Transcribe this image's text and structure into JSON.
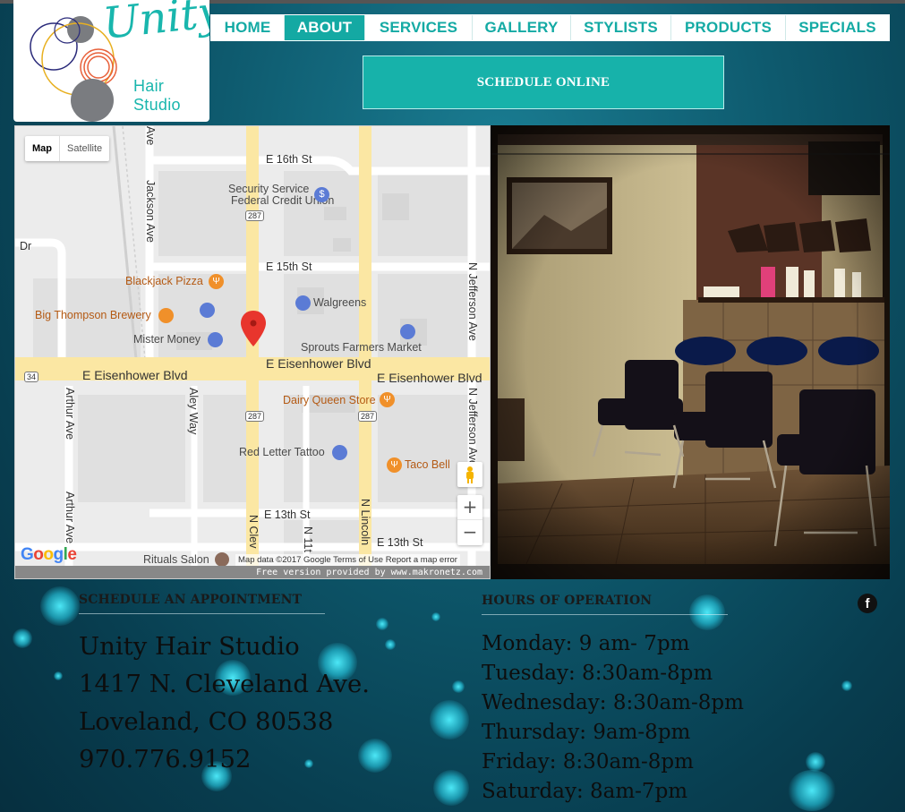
{
  "logo": {
    "script": "Unity",
    "sub": "Hair Studio"
  },
  "nav": {
    "items": [
      {
        "label": "HOME",
        "active": false
      },
      {
        "label": "ABOUT",
        "active": true
      },
      {
        "label": "SERVICES",
        "active": false
      },
      {
        "label": "GALLERY",
        "active": false
      },
      {
        "label": "STYLISTS",
        "active": false
      },
      {
        "label": "PRODUCTS",
        "active": false
      },
      {
        "label": "SPECIALS",
        "active": false
      }
    ]
  },
  "schedule_button": "SCHEDULE ONLINE",
  "map": {
    "toggle": [
      "Map",
      "Satellite"
    ],
    "streets": {
      "e16": "E 16th St",
      "e15": "E 15th St",
      "e13a": "E 13th St",
      "e13b": "E 13th St",
      "eisen1": "E Eisenhower Blvd",
      "eisen2": "E Eisenhower Blvd",
      "eisen3": "E Eisenhower Blvd",
      "jackson": "Jackson Ave",
      "arthur1": "Arthur Ave",
      "arthur2": "Arthur Ave",
      "alley": "Aley Way",
      "jefferson1": "N Jefferson Ave",
      "jefferson2": "N Jefferson Ave",
      "lincoln": "N Lincoln",
      "cleveland": "N Clev",
      "n11": "N 11t",
      "dr": "Dr",
      "ave_top": "Ave"
    },
    "pois": {
      "security": "Security Service",
      "security2": "Federal Credit Union",
      "blackjack": "Blackjack Pizza",
      "walgreens": "Walgreens",
      "bigthompson": "Big Thompson Brewery",
      "mistermoney": "Mister Money",
      "sprouts": "Sprouts Farmers Market",
      "dairyqueen": "Dairy Queen Store",
      "redletter": "Red Letter Tattoo",
      "tacobell": "Taco Bell",
      "rituals": "Rituals Salon"
    },
    "shields": {
      "s287a": "287",
      "s287b": "287",
      "s287c": "287",
      "s34": "34"
    },
    "google": [
      "G",
      "o",
      "o",
      "g",
      "l",
      "e"
    ],
    "attribution": "Map data ©2017 Google   Terms of Use   Report a map error",
    "footer": "Free version provided by www.makronetz.com",
    "zoom_in": "+",
    "zoom_out": "−"
  },
  "appointment": {
    "title": "SCHEDULE AN APPOINTMENT",
    "lines": [
      "Unity Hair Studio",
      "1417 N. Cleveland Ave.",
      "Loveland, CO 80538",
      "970.776.9152"
    ]
  },
  "hours": {
    "title": "HOURS OF OPERATION",
    "lines": [
      "Monday: 9 am- 7pm",
      "Tuesday: 8:30am-8pm",
      "Wednesday: 8:30am-8pm",
      "Thursday: 9am-8pm",
      "Friday: 8:30am-8pm",
      "Saturday: 8am-7pm"
    ]
  },
  "social": {
    "facebook": "f"
  },
  "colors": {
    "accent": "#14a9a3",
    "page_bg": "#0e5a6e"
  }
}
